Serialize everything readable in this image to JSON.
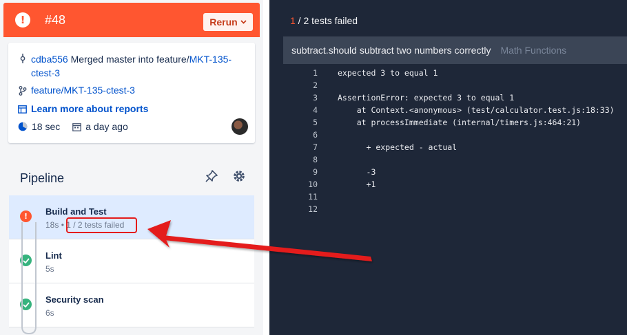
{
  "build": {
    "number": "#48",
    "rerun_label": "Rerun",
    "status_symbol": "!"
  },
  "info": {
    "commit_hash": "cdba556",
    "commit_message_prefix": "Merged master into feature/",
    "commit_message_link": "MKT-135-",
    "commit_message_tail": "ctest-3",
    "branch": "feature/MKT-135-ctest-3",
    "learn_more": "Learn more about reports",
    "duration": "18 sec",
    "when": "a day ago"
  },
  "pipeline": {
    "title": "Pipeline",
    "steps": [
      {
        "name": "Build and Test",
        "time": "18s",
        "separator": "•",
        "detail": "1 / 2 tests failed",
        "status": "failed"
      },
      {
        "name": "Lint",
        "time": "5s",
        "status": "success"
      },
      {
        "name": "Security scan",
        "time": "6s",
        "status": "success"
      }
    ]
  },
  "results": {
    "failed_count": "1",
    "summary_rest": " / 2 tests failed",
    "test_name": "subtract.should subtract two numbers correctly",
    "suite_name": "Math Functions",
    "lines": [
      {
        "n": "1",
        "t": "expected 3 to equal 1"
      },
      {
        "n": "2",
        "t": ""
      },
      {
        "n": "3",
        "t": "AssertionError: expected 3 to equal 1"
      },
      {
        "n": "4",
        "t": "    at Context.<anonymous> (test/calculator.test.js:18:33)"
      },
      {
        "n": "5",
        "t": "    at processImmediate (internal/timers.js:464:21)"
      },
      {
        "n": "6",
        "t": ""
      },
      {
        "n": "7",
        "t": "      + expected - actual"
      },
      {
        "n": "8",
        "t": ""
      },
      {
        "n": "9",
        "t": "      -3"
      },
      {
        "n": "10",
        "t": "      +1"
      },
      {
        "n": "11",
        "t": ""
      },
      {
        "n": "12",
        "t": ""
      }
    ]
  },
  "colors": {
    "error": "#ff5630",
    "success": "#36b37e",
    "link": "#0052cc",
    "code_bg": "#1e2738",
    "annotation": "#e41b1b"
  }
}
